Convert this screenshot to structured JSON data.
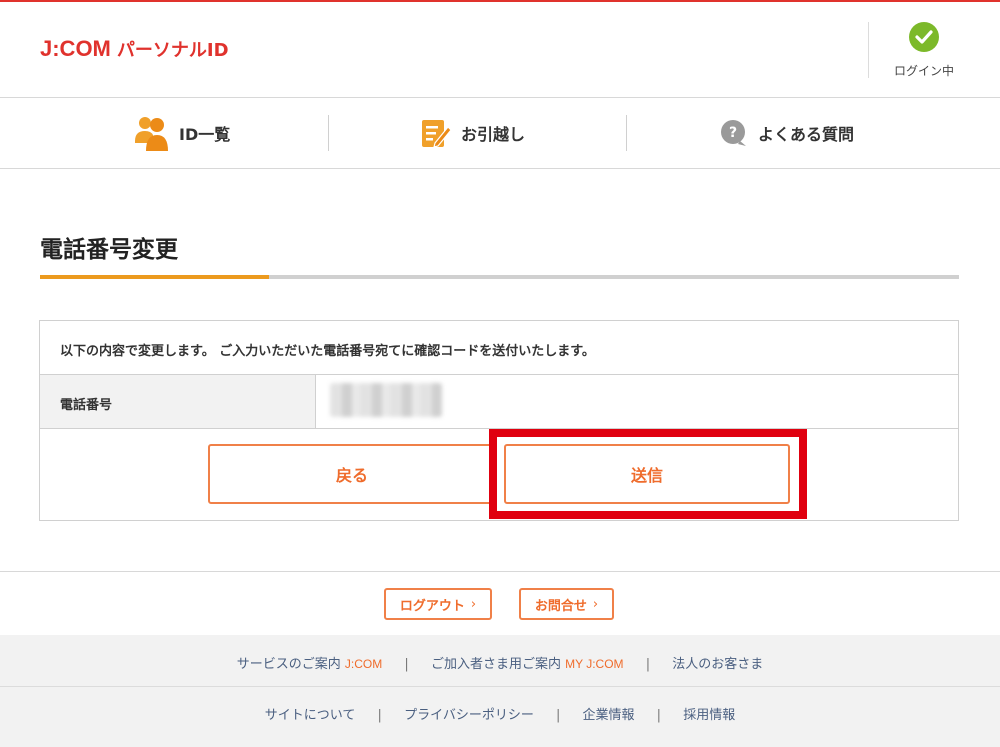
{
  "header": {
    "logo_brand": "J:COM",
    "logo_sub": "パーソナルID",
    "login_status": "ログイン中"
  },
  "nav": {
    "items": [
      {
        "label": "ID一覧",
        "icon": "users-icon"
      },
      {
        "label": "お引越し",
        "icon": "edit-note-icon"
      },
      {
        "label": "よくある質問",
        "icon": "question-icon"
      }
    ]
  },
  "page": {
    "title": "電話番号変更",
    "message": "以下の内容で変更します。 ご入力いただいた電話番号宛てに確認コードを送付いたします。",
    "field_label": "電話番号",
    "back_label": "戻る",
    "send_label": "送信"
  },
  "footer": {
    "logout_label": "ログアウト",
    "contact_label": "お問合せ",
    "links_row1": [
      {
        "label": "サービスのご案内",
        "brand": "J:COM"
      },
      {
        "label": "ご加入者さま用ご案内",
        "brand": "MY J:COM"
      },
      {
        "label": "法人のお客さま",
        "brand": ""
      }
    ],
    "links_row2": [
      "サイトについて",
      "プライバシーポリシー",
      "企業情報",
      "採用情報"
    ],
    "separator": "|",
    "chevron": "›"
  },
  "colors": {
    "brand_red": "#e0322d",
    "accent_orange": "#ef6c2c",
    "title_underline": "#ec9a1e",
    "check_green": "#7cb92a",
    "highlight_red": "#e0000f",
    "link_blue": "#4a5f80"
  }
}
